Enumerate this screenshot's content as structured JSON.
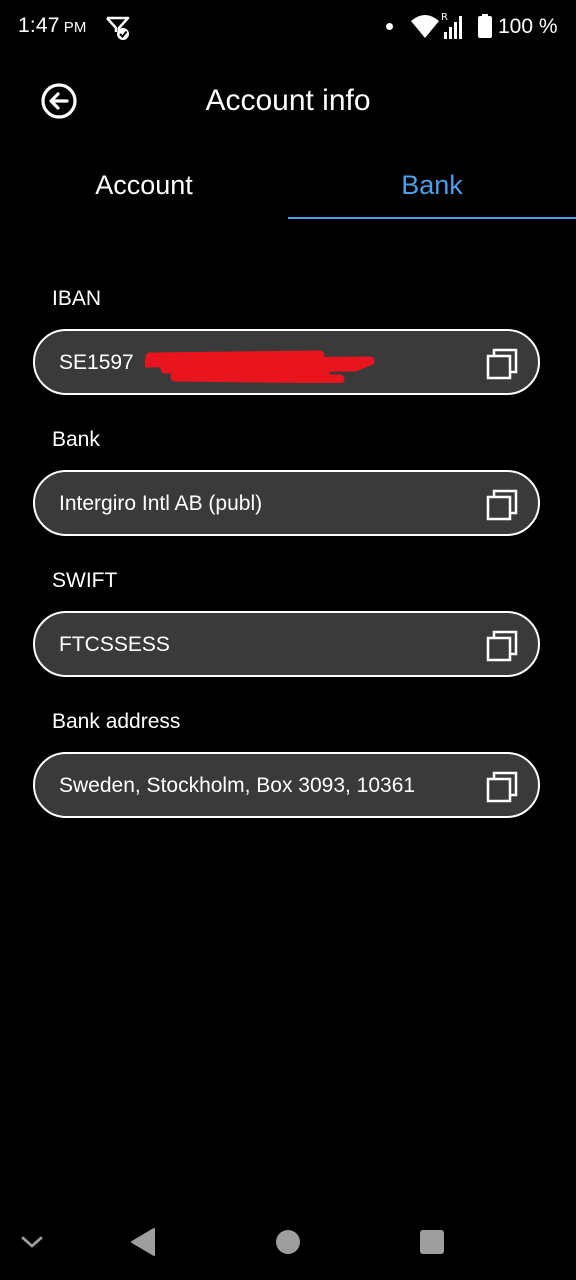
{
  "status_bar": {
    "time": "1:47",
    "ampm": "PM",
    "battery": "100 %",
    "left_icon": "notification-check-icon",
    "right_icons": [
      "dot-icon",
      "wifi-icon",
      "cell-signal-icon",
      "battery-icon"
    ]
  },
  "header": {
    "title": "Account info",
    "back_icon": "back-arrow-circle-icon"
  },
  "tabs": [
    {
      "label": "Account",
      "selected": false
    },
    {
      "label": "Bank",
      "selected": true
    }
  ],
  "fields": [
    {
      "label": "IBAN",
      "value": "SE1597",
      "redacted": true,
      "action_icon": "copy-icon"
    },
    {
      "label": "Bank",
      "value": "Intergiro Intl AB (publ)",
      "action_icon": "copy-icon"
    },
    {
      "label": "SWIFT",
      "value": "FTCSSESS",
      "action_icon": "copy-icon"
    },
    {
      "label": "Bank address",
      "value": "Sweden, Stockholm, Box 3093, 10361",
      "action_icon": "copy-icon"
    }
  ],
  "nav_bar": {
    "icons": [
      "chevron-down-icon",
      "back-triangle-icon",
      "home-circle-icon",
      "recents-square-icon"
    ]
  },
  "colors": {
    "background": "#000000",
    "accent": "#4a9fe8",
    "field_fill": "#3a3a3a",
    "field_border": "#ffffff",
    "redaction": "#e8141e",
    "nav_icons": "#9e9e9e"
  }
}
